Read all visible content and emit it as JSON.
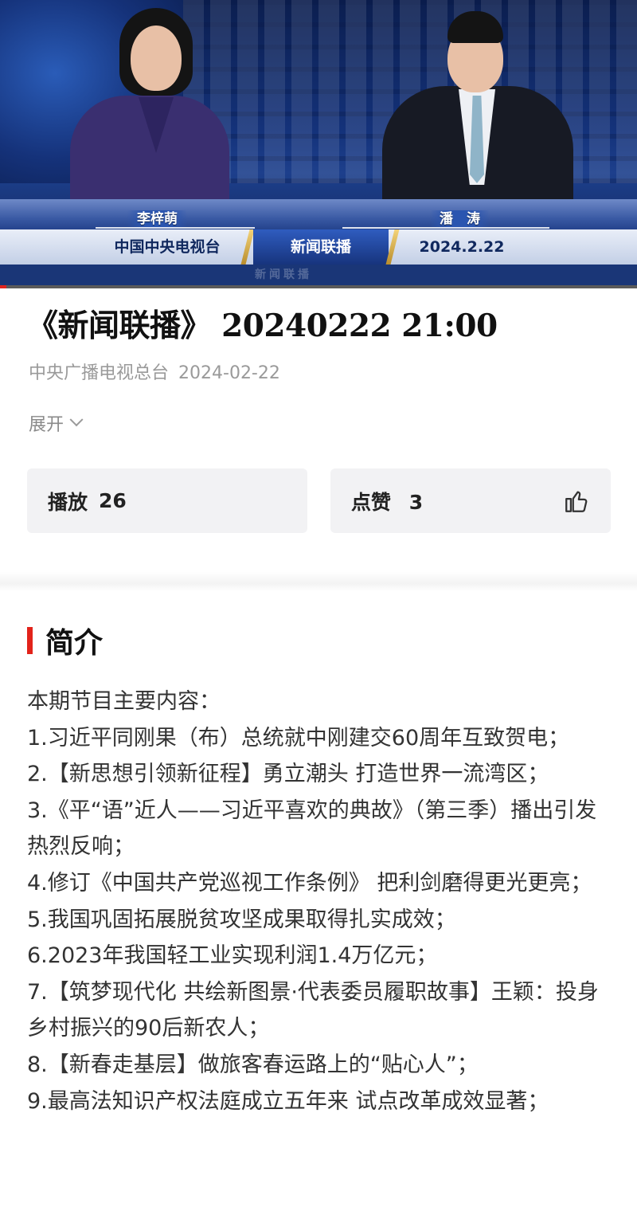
{
  "video": {
    "anchor_female": "李梓萌",
    "anchor_male": "潘　涛",
    "banner_channel": "中国中央电视台",
    "banner_program": "新闻联播",
    "banner_date": "2024.2.22",
    "banner_sub": "新闻联播",
    "progress_percent": 1,
    "accent_color": "#e0241f"
  },
  "header": {
    "title": "《新闻联播》 20240222 21:00",
    "source": "中央广播电视总台",
    "date": "2024-02-22",
    "expand_label": "展开"
  },
  "stats": {
    "play_label": "播放",
    "play_count": "26",
    "like_label": "点赞",
    "like_count": "3",
    "like_icon": "thumbs-up-icon"
  },
  "intro": {
    "heading": "简介",
    "accent_color": "#e2231a",
    "lines": [
      "本期节目主要内容：",
      "1.习近平同刚果（布）总统就中刚建交60周年互致贺电；",
      "2.【新思想引领新征程】勇立潮头 打造世界一流湾区；",
      "3.《平“语”近人——习近平喜欢的典故》（第三季）播出引发热烈反响；",
      "4.修订《中国共产党巡视工作条例》 把利剑磨得更光更亮；",
      "5.我国巩固拓展脱贫攻坚成果取得扎实成效；",
      "6.2023年我国轻工业实现利润1.4万亿元；",
      "7.【筑梦现代化 共绘新图景·代表委员履职故事】王颖：投身乡村振兴的90后新农人；",
      "8.【新春走基层】做旅客春运路上的“贴心人”；",
      "9.最高法知识产权法庭成立五年来 试点改革成效显著；"
    ]
  }
}
